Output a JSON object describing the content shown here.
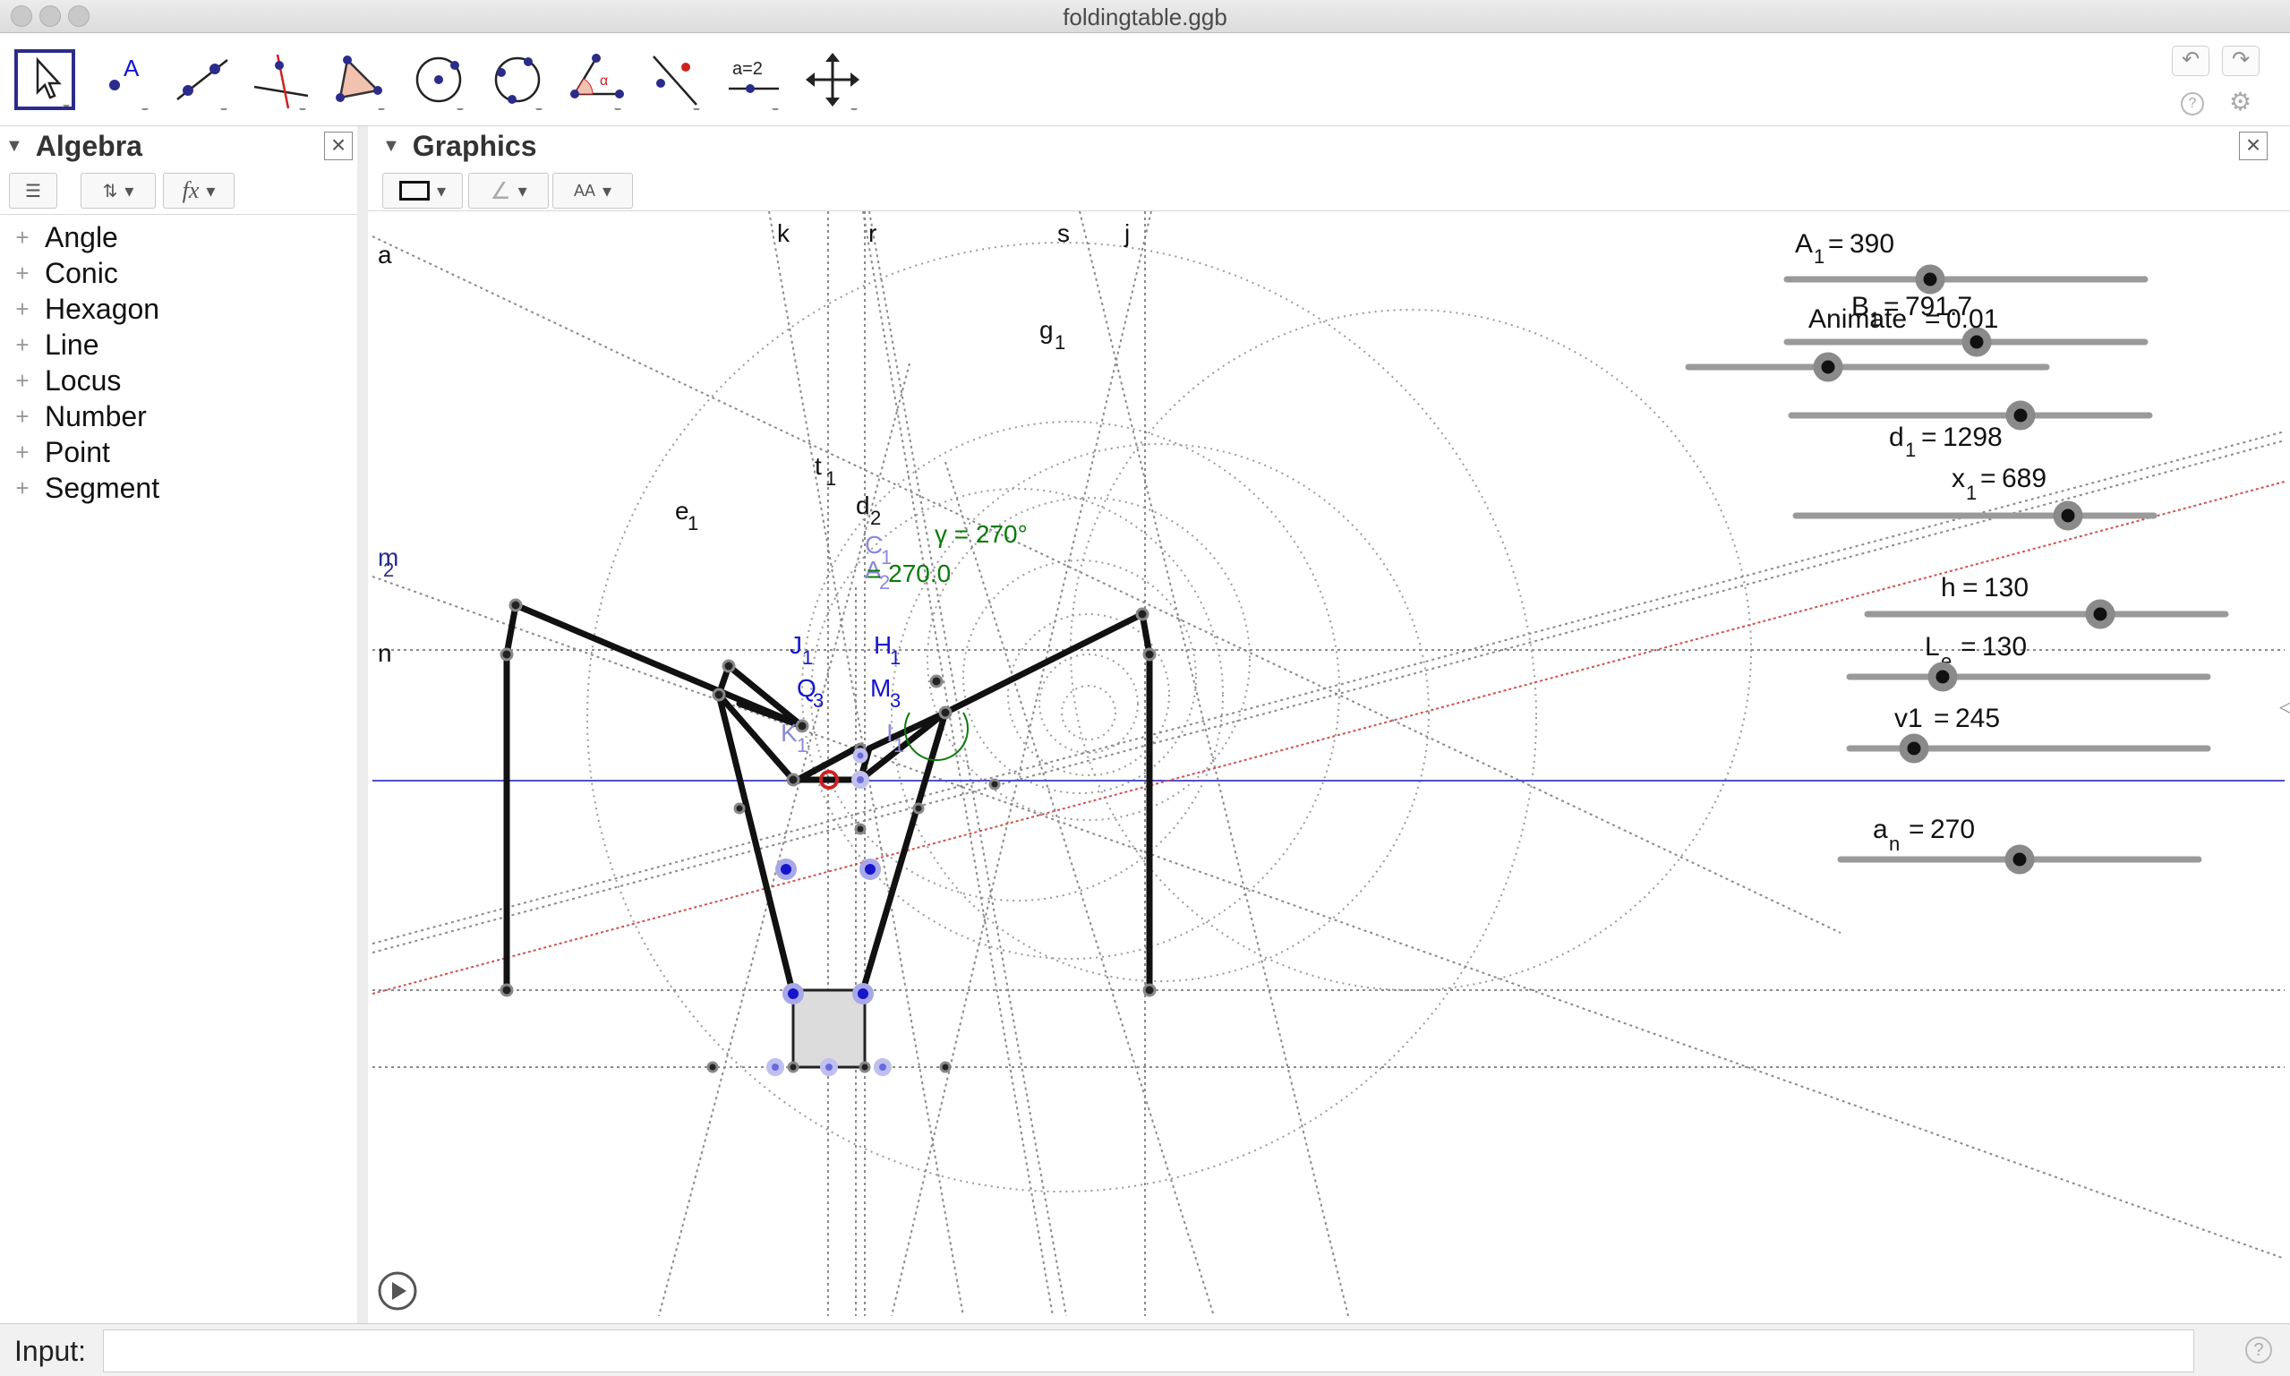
{
  "window": {
    "title": "foldingtable.ggb"
  },
  "toolbar": {
    "tools": [
      {
        "name": "move-tool",
        "label": ""
      },
      {
        "name": "point-tool",
        "label": "A"
      },
      {
        "name": "line-tool",
        "label": ""
      },
      {
        "name": "perpendicular-line-tool",
        "label": ""
      },
      {
        "name": "polygon-tool",
        "label": ""
      },
      {
        "name": "circle-tool",
        "label": ""
      },
      {
        "name": "conic-tool",
        "label": ""
      },
      {
        "name": "angle-tool",
        "label": "α"
      },
      {
        "name": "reflect-tool",
        "label": ""
      },
      {
        "name": "slider-tool",
        "label": "a=2"
      },
      {
        "name": "move-graphics-view-tool",
        "label": ""
      }
    ],
    "undo_icon": "↶",
    "redo_icon": "↷",
    "help_icon": "?",
    "settings_icon": "⚙"
  },
  "algebra": {
    "title": "Algebra",
    "categories": [
      "Angle",
      "Conic",
      "Hexagon",
      "Line",
      "Locus",
      "Number",
      "Point",
      "Segment"
    ]
  },
  "graphics": {
    "title": "Graphics",
    "sliders": [
      {
        "name": "A_1",
        "sub": "1",
        "base": "A",
        "value": "390",
        "frac": 0.4
      },
      {
        "name": "B_1",
        "sub": "1",
        "base": "B",
        "value": "791.7",
        "frac": 0.53
      },
      {
        "name": "Animate",
        "sub": "",
        "base": "Animate",
        "value": "0.01",
        "frac": 0.39
      },
      {
        "name": "unnamed",
        "sub": "",
        "base": "",
        "value": "",
        "frac": 0.64
      },
      {
        "name": "d_1",
        "sub": "1",
        "base": "d",
        "value": "1298",
        "frac": null
      },
      {
        "name": "x_1",
        "sub": "1",
        "base": "x",
        "value": "689",
        "frac": 0.76
      },
      {
        "name": "h",
        "sub": "",
        "base": "h",
        "value": "130",
        "frac": 0.65
      },
      {
        "name": "L_e",
        "sub": "e",
        "base": "L",
        "value": "130",
        "frac": 0.26
      },
      {
        "name": "v1",
        "sub": "",
        "base": "v1",
        "value": "245",
        "frac": 0.18
      },
      {
        "name": "a_n",
        "sub": "n",
        "base": "a",
        "value": "270",
        "frac": 0.5
      }
    ],
    "line_labels": [
      "a",
      "k",
      "r",
      "s",
      "j",
      "n",
      "m",
      "2",
      "g",
      "1",
      "t",
      "1",
      "d",
      "2",
      "e",
      "1"
    ],
    "point_labels": [
      {
        "base": "C",
        "sub": "1"
      },
      {
        "base": "A",
        "sub": "2"
      },
      {
        "base": "J",
        "sub": "1"
      },
      {
        "base": "H",
        "sub": "1"
      },
      {
        "base": "Q",
        "sub": "3"
      },
      {
        "base": "M",
        "sub": "3"
      },
      {
        "base": "K",
        "sub": "1"
      },
      {
        "base": "I",
        "sub": "1"
      }
    ],
    "angle_labels": [
      "γ = 270°",
      "= 270.0"
    ],
    "colors": {
      "accent": "#2b2b8c",
      "blue_point": "#1515cc",
      "red_line": "#cc3333",
      "green_angle": "#0a7a0a"
    }
  },
  "input": {
    "label": "Input:",
    "value": ""
  }
}
